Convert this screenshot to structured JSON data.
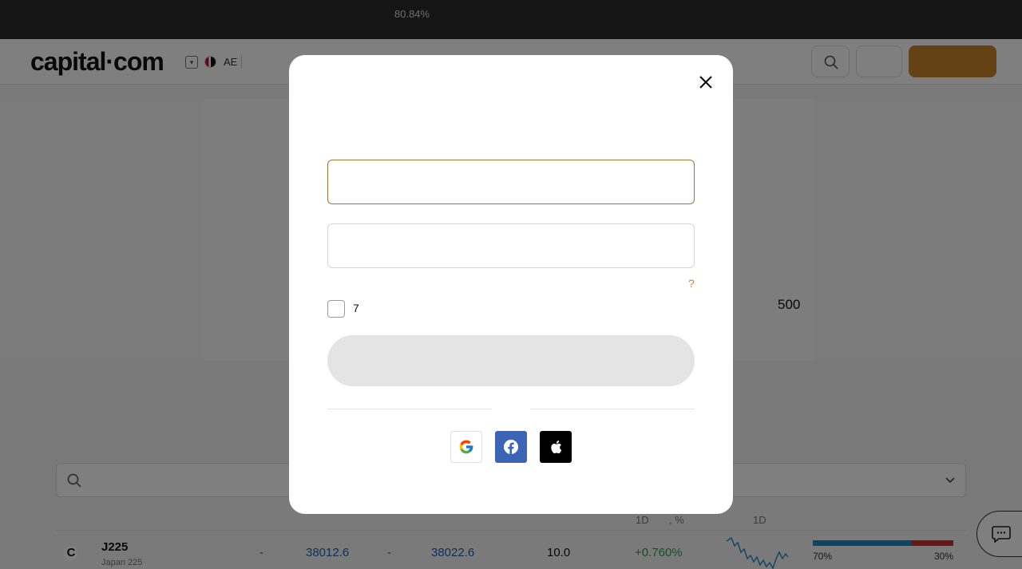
{
  "top_strip": {
    "percent": "80.84%"
  },
  "header": {
    "logo": "capital·com",
    "language": "AE",
    "icons": [
      "chevron-down-icon",
      "uae-flag-icon",
      "search-icon"
    ]
  },
  "hero": {
    "number": "500"
  },
  "market_table": {
    "headers": {
      "change_1d": "1D",
      "change_pct": ", %",
      "chart_1d": "1D"
    },
    "rows": [
      {
        "symbol": "J225",
        "name": "Japan 225",
        "sell_dash": "-",
        "sell": "38012.6",
        "buy_dash": "-",
        "buy": "38022.6",
        "spread": "10.0",
        "change": "+0.760%",
        "buy_pct": "70%",
        "sell_pct": "30%",
        "buy_fraction": 0.7
      }
    ]
  },
  "modal": {
    "forgot_label": "?",
    "checkbox_label": "7",
    "email_value": "",
    "password_value": "",
    "checkbox_checked": false,
    "social_icons": [
      "google-icon",
      "facebook-icon",
      "apple-icon"
    ]
  },
  "colors": {
    "accent": "#c9842d",
    "email_border": "#a2723c",
    "facebook": "#3b64b4",
    "price_blue": "#1f5fb8",
    "positive_green": "#2a9d4b"
  }
}
